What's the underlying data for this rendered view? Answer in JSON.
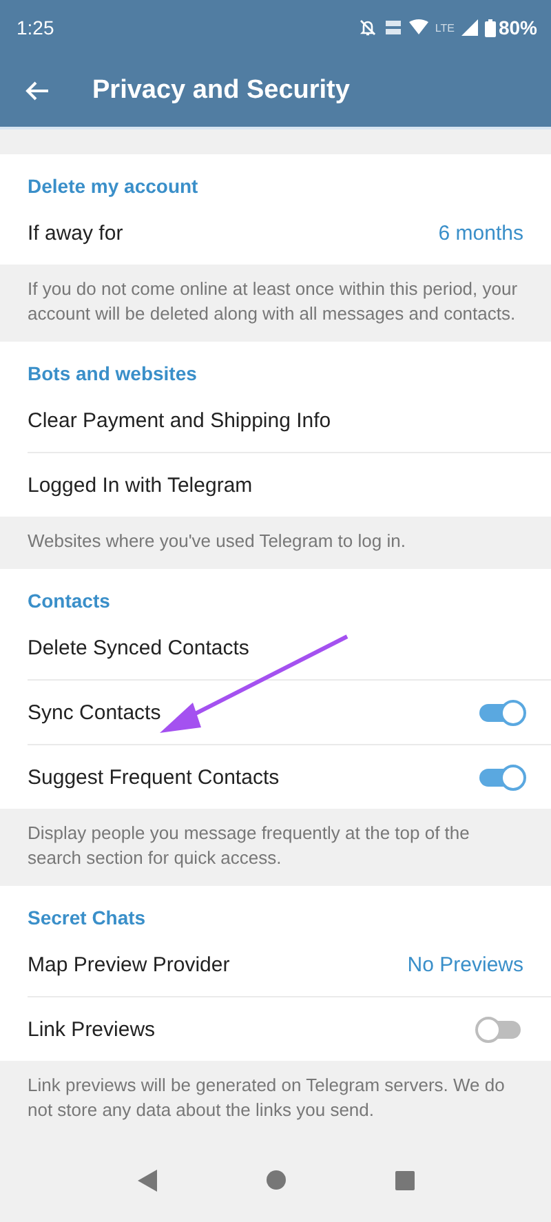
{
  "status_bar": {
    "time": "1:25",
    "network": "LTE",
    "battery": "80%"
  },
  "header": {
    "title": "Privacy and Security"
  },
  "sections": [
    {
      "title": "Delete my account",
      "rows": [
        {
          "kind": "value",
          "label": "If away for",
          "value": "6 months"
        }
      ],
      "info": "If you do not come online at least once within this period, your account will be deleted along with all messages and contacts."
    },
    {
      "title": "Bots and websites",
      "rows": [
        {
          "kind": "plain",
          "label": "Clear Payment and Shipping Info"
        },
        {
          "kind": "plain",
          "label": "Logged In with Telegram"
        }
      ],
      "info": "Websites where you've used Telegram to log in."
    },
    {
      "title": "Contacts",
      "rows": [
        {
          "kind": "plain",
          "label": "Delete Synced Contacts"
        },
        {
          "kind": "toggle",
          "label": "Sync Contacts",
          "on": true
        },
        {
          "kind": "toggle",
          "label": "Suggest Frequent Contacts",
          "on": true
        }
      ],
      "info": "Display people you message frequently at the top of the search section for quick access."
    },
    {
      "title": "Secret Chats",
      "rows": [
        {
          "kind": "value",
          "label": "Map Preview Provider",
          "value": "No Previews"
        },
        {
          "kind": "toggle",
          "label": "Link Previews",
          "on": false
        }
      ],
      "info": "Link previews will be generated on Telegram servers. We do not store any data about the links you send."
    }
  ]
}
